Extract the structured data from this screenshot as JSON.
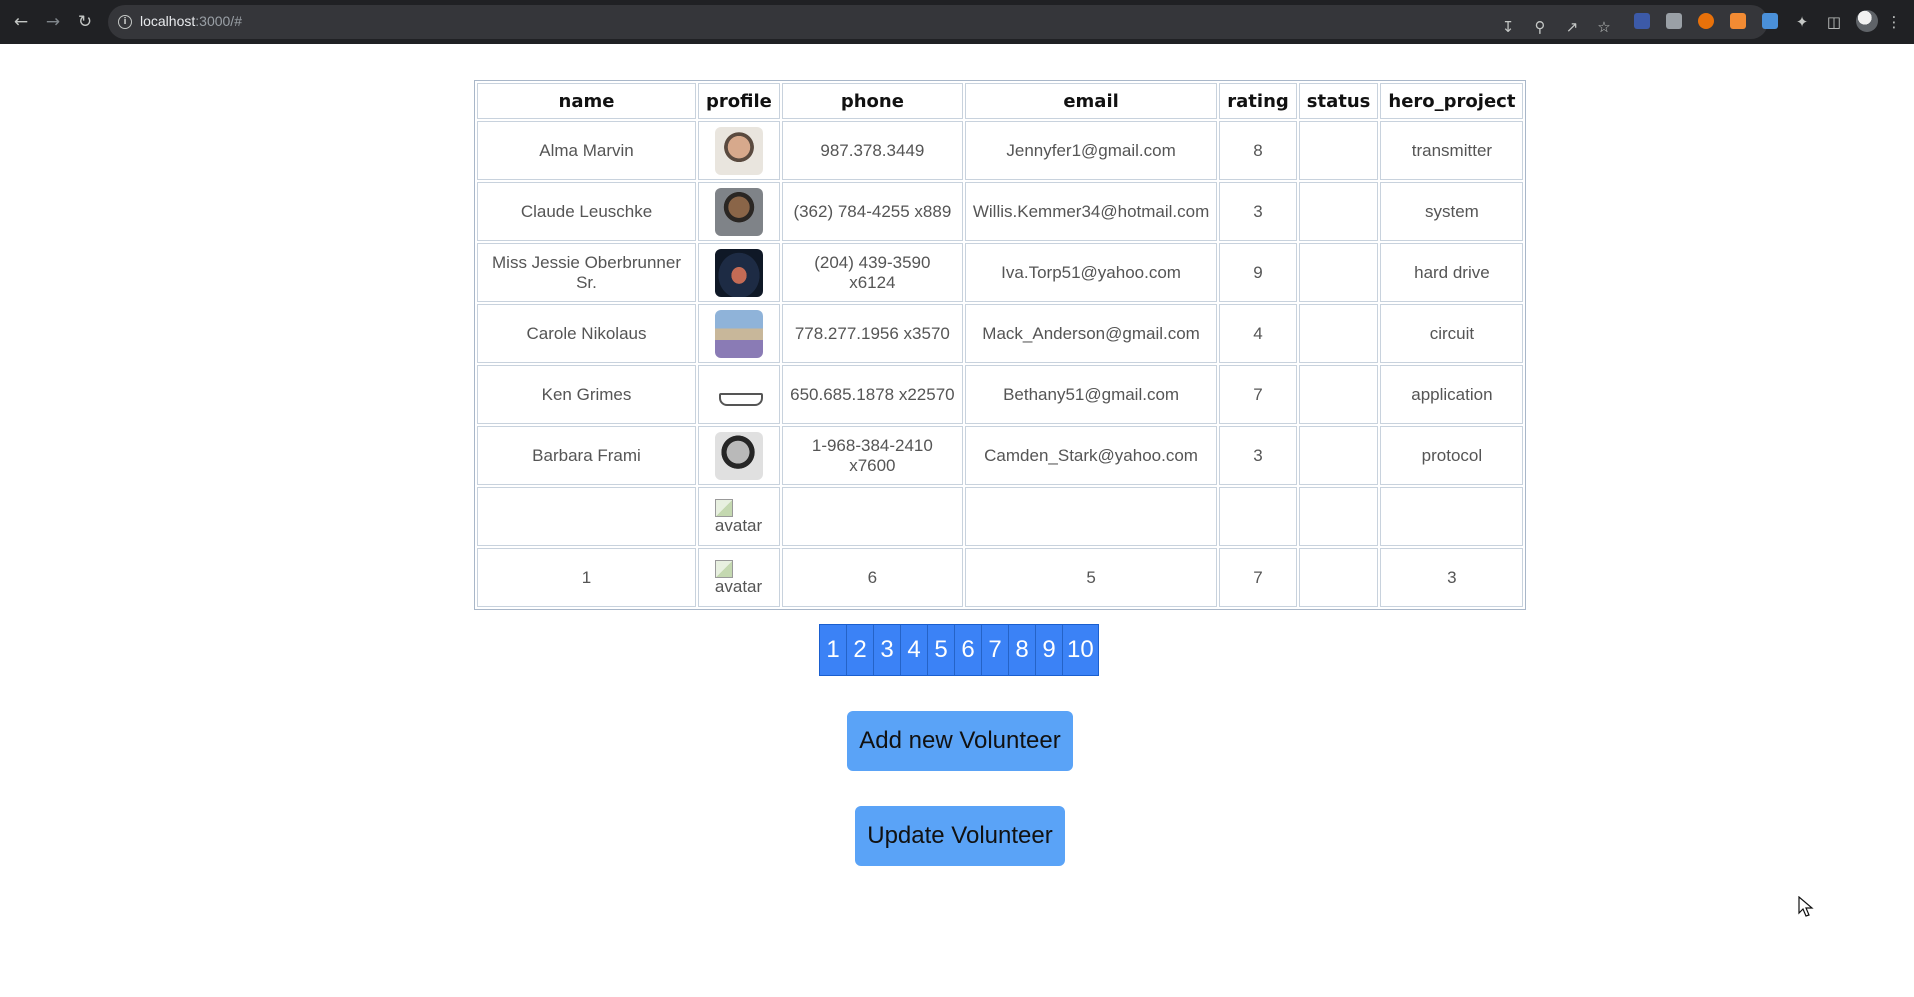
{
  "browser": {
    "url_host": "localhost",
    "url_rest": ":3000/#"
  },
  "table": {
    "headers": {
      "name": "name",
      "profile": "profile",
      "phone": "phone",
      "email": "email",
      "rating": "rating",
      "status": "status",
      "hero_project": "hero_project"
    },
    "rows": [
      {
        "name": "Alma Marvin",
        "profile": "photo",
        "phone": "987.378.3449",
        "email": "Jennyfer1@gmail.com",
        "rating": "8",
        "status": "",
        "hero_project": "transmitter"
      },
      {
        "name": "Claude Leuschke",
        "profile": "photo",
        "phone": "(362) 784-4255 x889",
        "email": "Willis.Kemmer34@hotmail.com",
        "rating": "3",
        "status": "",
        "hero_project": "system"
      },
      {
        "name": "Miss Jessie Oberbrunner Sr.",
        "profile": "photo",
        "phone": "(204) 439-3590 x6124",
        "email": "Iva.Torp51@yahoo.com",
        "rating": "9",
        "status": "",
        "hero_project": "hard drive"
      },
      {
        "name": "Carole Nikolaus",
        "profile": "photo",
        "phone": "778.277.1956 x3570",
        "email": "Mack_Anderson@gmail.com",
        "rating": "4",
        "status": "",
        "hero_project": "circuit"
      },
      {
        "name": "Ken Grimes",
        "profile": "photo",
        "phone": "650.685.1878 x22570",
        "email": "Bethany51@gmail.com",
        "rating": "7",
        "status": "",
        "hero_project": "application"
      },
      {
        "name": "Barbara Frami",
        "profile": "photo",
        "phone": "1-968-384-2410 x7600",
        "email": "Camden_Stark@yahoo.com",
        "rating": "3",
        "status": "",
        "hero_project": "protocol"
      },
      {
        "name": "",
        "profile": "avatar",
        "phone": "",
        "email": "",
        "rating": "",
        "status": "",
        "hero_project": ""
      },
      {
        "name": "1",
        "profile": "avatar",
        "phone": "6",
        "email": "5",
        "rating": "7",
        "status": "",
        "hero_project": "3"
      }
    ]
  },
  "pagination": {
    "pages": [
      "1",
      "2",
      "3",
      "4",
      "5",
      "6",
      "7",
      "8",
      "9",
      "10"
    ]
  },
  "actions": {
    "add_label": "Add new Volunteer",
    "update_label": "Update Volunteer"
  },
  "colors": {
    "accent": "#3b82f6",
    "button": "#5aa3f7",
    "chrome": "#202124"
  },
  "icons": {
    "back": "back-arrow-icon",
    "forward": "forward-arrow-icon",
    "reload": "reload-icon",
    "info": "info-icon"
  }
}
